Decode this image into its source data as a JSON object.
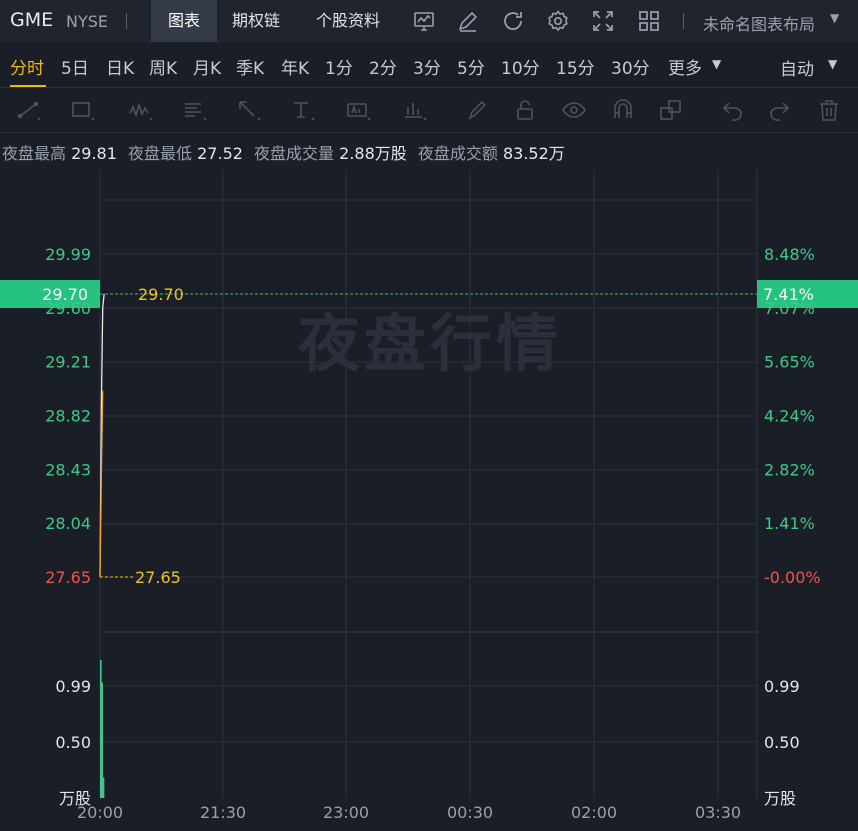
{
  "header": {
    "ticker": "GME",
    "exchange": "NYSE",
    "tabs": [
      "图表",
      "期权链",
      "个股资料"
    ],
    "layout_name": "未命名图表布局"
  },
  "periods": {
    "items": [
      "分时",
      "5日",
      "日K",
      "周K",
      "月K",
      "季K",
      "年K",
      "1分",
      "2分",
      "3分",
      "5分",
      "10分",
      "15分",
      "30分",
      "更多"
    ],
    "active": "分时",
    "mode": "自动"
  },
  "stats": {
    "high_label": "夜盘最高",
    "high": "29.81",
    "low_label": "夜盘最低",
    "low": "27.52",
    "vol_label": "夜盘成交量",
    "vol": "2.88万股",
    "amt_label": "夜盘成交额",
    "amt": "83.52万"
  },
  "chart_data": {
    "type": "line",
    "watermark": "夜盘行情",
    "price_axis_left": [
      "29.99",
      "29.60",
      "29.21",
      "28.82",
      "28.43",
      "28.04",
      "27.65"
    ],
    "price_axis_right": [
      "8.48%",
      "7.07%",
      "5.65%",
      "4.24%",
      "2.82%",
      "1.41%",
      "-0.00%"
    ],
    "price_range": [
      27.65,
      29.99
    ],
    "current_price": "29.70",
    "current_pct": "7.41%",
    "reference_price": "27.65",
    "volume_axis": [
      "0.99",
      "0.50"
    ],
    "volume_unit": "万股",
    "x_ticks": [
      "20:00",
      "21:30",
      "23:00",
      "00:30",
      "02:00",
      "03:30"
    ],
    "price_series": {
      "x": [
        "20:00",
        "20:01",
        "20:02",
        "20:03"
      ],
      "y": [
        27.65,
        28.9,
        29.6,
        29.7
      ]
    },
    "avg_series": {
      "x": [
        "20:00",
        "20:01",
        "20:02"
      ],
      "y": [
        27.65,
        28.4,
        29.0
      ]
    },
    "volume_series": {
      "x": [
        "20:00",
        "20:01",
        "20:02"
      ],
      "y": [
        1.22,
        1.02,
        0.18
      ]
    },
    "colors": {
      "up": "#3ec98a",
      "down": "#ef5350",
      "price_line": "#e8e8e8",
      "avg_line": "#f0a030",
      "ref_line": "#f0c419",
      "current_tag": "#26c281"
    }
  }
}
